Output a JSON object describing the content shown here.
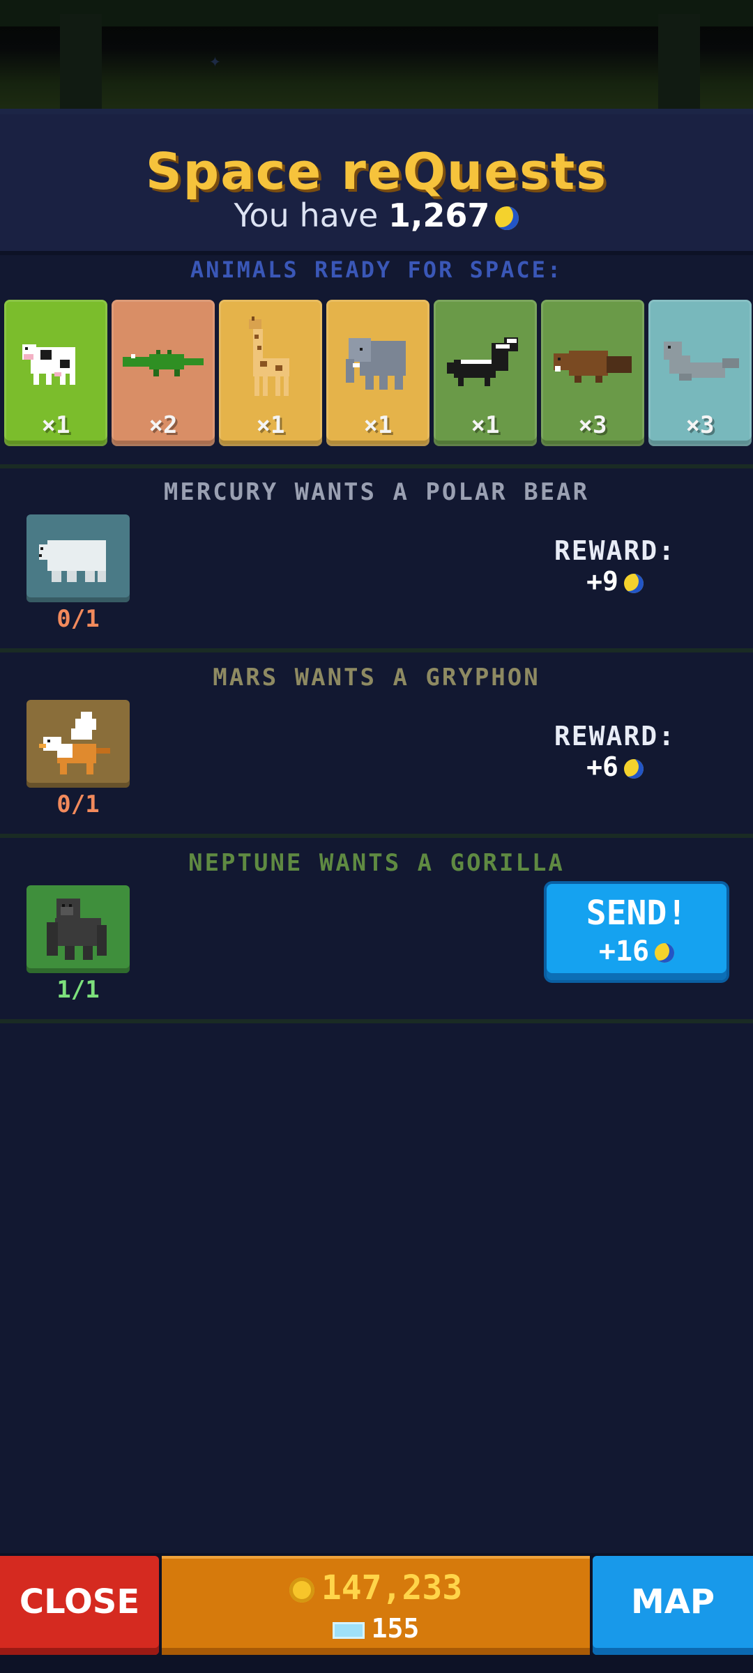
{
  "header": {
    "title": "Space reQuests",
    "balance_prefix": "You have",
    "balance": "1,267"
  },
  "section_label": "ANIMALS READY FOR SPACE:",
  "animals": [
    {
      "name": "cow",
      "count": "×1",
      "color": "#7bbd2c"
    },
    {
      "name": "crocodile",
      "count": "×2",
      "color": "#d98e66"
    },
    {
      "name": "giraffe",
      "count": "×1",
      "color": "#e5b34a"
    },
    {
      "name": "elephant",
      "count": "×1",
      "color": "#e5b34a"
    },
    {
      "name": "skunk",
      "count": "×1",
      "color": "#6a9a48"
    },
    {
      "name": "beaver",
      "count": "×3",
      "color": "#6a9a48"
    },
    {
      "name": "seal",
      "count": "×3",
      "color": "#78b8bc"
    }
  ],
  "requests": [
    {
      "title": "MERCURY WANTS A POLAR BEAR",
      "animal": "polar-bear",
      "progress": "0/1",
      "reward_label": "REWARD:",
      "reward": "+9"
    },
    {
      "title": "MARS WANTS A GRYPHON",
      "animal": "gryphon",
      "progress": "0/1",
      "reward_label": "REWARD:",
      "reward": "+6"
    },
    {
      "title": "NEPTUNE WANTS A GORILLA",
      "animal": "gorilla",
      "progress": "1/1",
      "send_label": "SEND!",
      "reward": "+16"
    }
  ],
  "footer": {
    "close_label": "CLOSE",
    "coins": "147,233",
    "tickets": "155",
    "map_label": "MAP"
  },
  "colors": {
    "title": "#f6c33c",
    "send_button": "#15a2f0",
    "close_button": "#d52a20",
    "map_button": "#1899ea",
    "currency_panel": "#d67a0c"
  }
}
